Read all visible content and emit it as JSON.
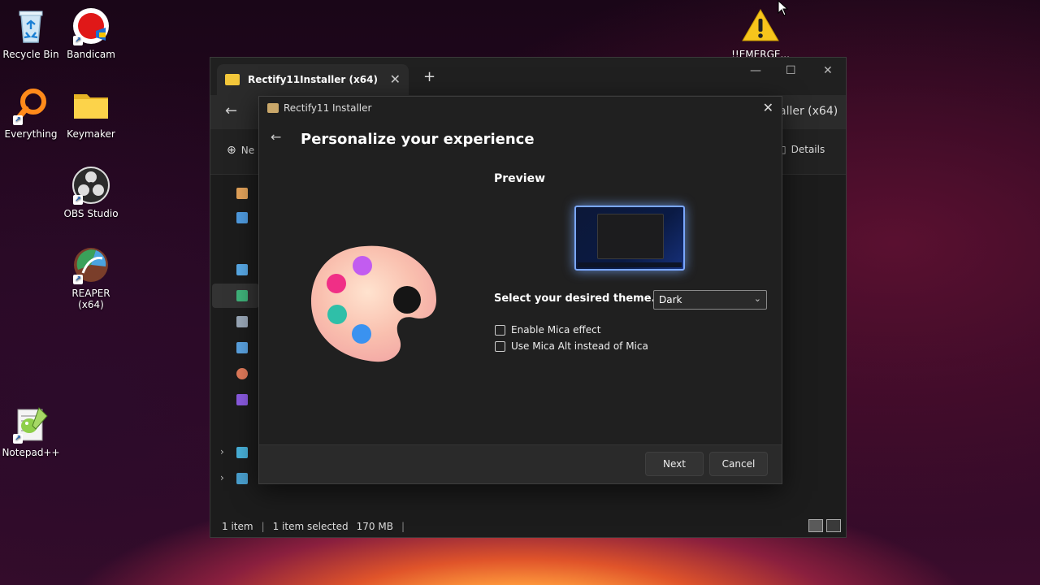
{
  "desktop": {
    "icons": [
      {
        "label": "Recycle Bin"
      },
      {
        "label": "Bandicam"
      },
      {
        "label": "Everything"
      },
      {
        "label": "Keymaker"
      },
      {
        "label": "OBS Studio"
      },
      {
        "label": "REAPER (x64)"
      },
      {
        "label": "Notepad++"
      },
      {
        "label": "!!EMERGE..."
      }
    ]
  },
  "explorer": {
    "tab_title": "Rectify11Installer (x64)",
    "address_partial": "aller (x64)",
    "new_label": "Ne",
    "details_label": "Details",
    "status": {
      "item_count": "1 item",
      "selected": "1 item selected",
      "size": "170 MB"
    }
  },
  "installer": {
    "window_title": "Rectify11 Installer",
    "heading": "Personalize your experience",
    "preview_label": "Preview",
    "theme_label": "Select your desired theme.",
    "theme_value": "Dark",
    "options": [
      {
        "label": "Enable Mica effect",
        "checked": false
      },
      {
        "label": "Use Mica Alt instead of Mica",
        "checked": false
      }
    ],
    "next_label": "Next",
    "cancel_label": "Cancel"
  },
  "colors": {
    "dialog_bg": "#202020",
    "footer_bg": "#2a2a2a",
    "accent_glow": "#7aa7ff"
  }
}
